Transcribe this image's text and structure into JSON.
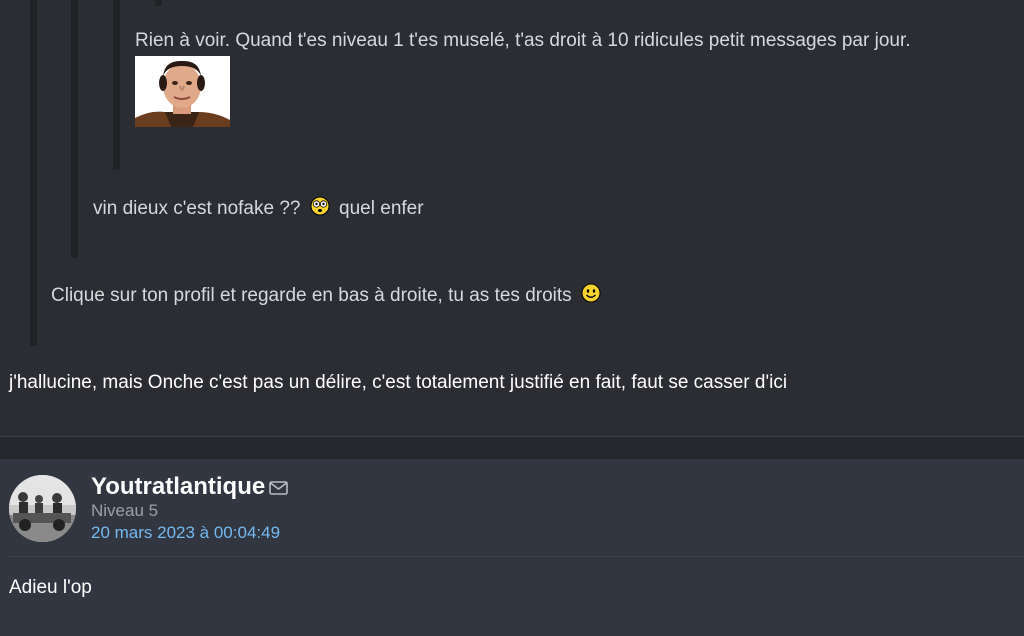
{
  "quotes": {
    "level3_text": "Rien à voir. Quand t'es niveau 1 t'es muselé, t'as droit à 10 ridicules petit messages par jour.",
    "level2_text_before": "vin dieux c'est nofake ??",
    "level2_text_after": "quel enfer",
    "level1_text": "Clique sur ton profil et regarde en bas à droite, tu as tes droits"
  },
  "message_text": "j'hallucine, mais Onche c'est pas un délire, c'est totalement justifié en fait, faut se casser d'ici",
  "post": {
    "author": "Youtratlantique",
    "level": "Niveau 5",
    "date": "20 mars 2023 à 00:04:49",
    "body": "Adieu l'op"
  },
  "icons": {
    "mail": "mail-icon",
    "shocked_smiley": "shocked-smiley-icon",
    "happy_smiley": "happy-smiley-icon"
  },
  "colors": {
    "background": "#2b2d33",
    "quote_bar": "#202226",
    "post_background": "#323640",
    "date_link": "#74b9f0",
    "level_text": "#9aa0aa"
  }
}
